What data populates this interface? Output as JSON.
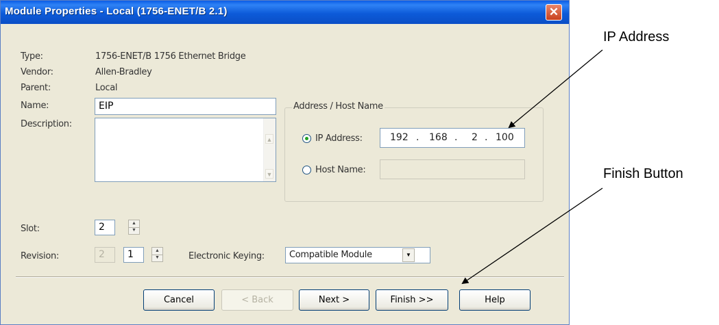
{
  "window": {
    "title": "Module Properties - Local (1756-ENET/B 2.1)",
    "close_glyph": "✕"
  },
  "info": {
    "type_label": "Type:",
    "type_value": "1756-ENET/B 1756 Ethernet Bridge",
    "vendor_label": "Vendor:",
    "vendor_value": "Allen-Bradley",
    "parent_label": "Parent:",
    "parent_value": "Local"
  },
  "form": {
    "name_label": "Name:",
    "name_value": "EIP",
    "description_label": "Description:",
    "description_value": "",
    "slot_label": "Slot:",
    "slot_value": "2",
    "revision_label": "Revision:",
    "revision_major": "2",
    "revision_minor": "1",
    "keying_label": "Electronic Keying:",
    "keying_value": "Compatible Module"
  },
  "address": {
    "group_label": "Address / Host Name",
    "ip_label": "IP Address:",
    "ip_selected": true,
    "ip_octets": [
      "192",
      "168",
      "2",
      "100"
    ],
    "ip_dot": ".",
    "host_label": "Host Name:",
    "host_value": ""
  },
  "buttons": {
    "cancel": "Cancel",
    "back": "< Back",
    "next": "Next >",
    "finish": "Finish >>",
    "help": "Help"
  },
  "annotations": {
    "ip": "IP Address",
    "finish": "Finish Button"
  }
}
